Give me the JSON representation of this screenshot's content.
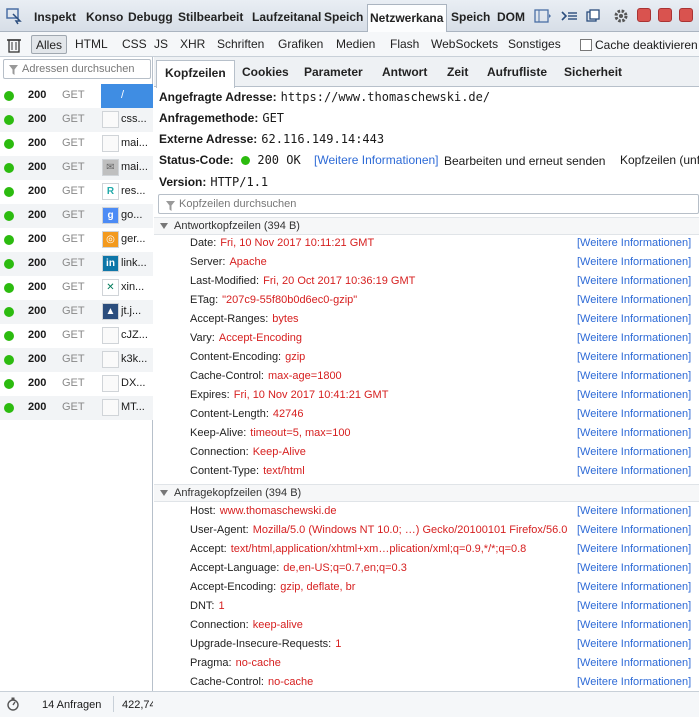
{
  "toolbar": {
    "tabs": [
      {
        "label": "Inspekt"
      },
      {
        "label": "Konso"
      },
      {
        "label": "Debugg"
      },
      {
        "label": "Stilbearbeit"
      },
      {
        "label": "Laufzeitanal"
      },
      {
        "label": "Speich"
      },
      {
        "label": "Netzwerkana"
      },
      {
        "label": "Speich"
      },
      {
        "label": "DOM"
      }
    ]
  },
  "filterbar": {
    "types": [
      "Alles",
      "HTML",
      "CSS",
      "JS",
      "XHR",
      "Schriften",
      "Grafiken",
      "Medien",
      "Flash",
      "WebSockets",
      "Sonstiges"
    ],
    "cache_label": "Cache deaktivieren"
  },
  "left": {
    "search_placeholder": "Adressen durchsuchen",
    "requests": [
      {
        "status": "200",
        "method": "GET",
        "file": "/"
      },
      {
        "status": "200",
        "method": "GET",
        "file": "css..."
      },
      {
        "status": "200",
        "method": "GET",
        "file": "mai..."
      },
      {
        "status": "200",
        "method": "GET",
        "file": "mai..."
      },
      {
        "status": "200",
        "method": "GET",
        "file": "res..."
      },
      {
        "status": "200",
        "method": "GET",
        "file": "go..."
      },
      {
        "status": "200",
        "method": "GET",
        "file": "ger..."
      },
      {
        "status": "200",
        "method": "GET",
        "file": "link..."
      },
      {
        "status": "200",
        "method": "GET",
        "file": "xin..."
      },
      {
        "status": "200",
        "method": "GET",
        "file": "jt.j..."
      },
      {
        "status": "200",
        "method": "GET",
        "file": "cJZ..."
      },
      {
        "status": "200",
        "method": "GET",
        "file": "k3k..."
      },
      {
        "status": "200",
        "method": "GET",
        "file": "DX..."
      },
      {
        "status": "200",
        "method": "GET",
        "file": "MT..."
      }
    ]
  },
  "status": {
    "requests": "14 Anfragen",
    "size": "422,74"
  },
  "panel": {
    "tabs": [
      "Kopfzeilen",
      "Cookies",
      "Parameter",
      "Antwort",
      "Zeit",
      "Aufrufliste",
      "Sicherheit"
    ],
    "summary": {
      "url_label": "Angefragte Adresse:",
      "url": "https://www.thomaschewski.de/",
      "method_label": "Anfragemethode:",
      "method": "GET",
      "remote_label": "Externe Adresse:",
      "remote": "62.116.149.14:443",
      "status_label": "Status-Code:",
      "status": "200 OK",
      "more_info": "[Weitere Informationen]",
      "edit_resend": "Bearbeiten und erneut senden",
      "raw_headers": "Kopfzeilen (unf",
      "version_label": "Version:",
      "version": "HTTP/1.1"
    },
    "header_search": "Kopfzeilen durchsuchen",
    "response_title": "Antwortkopfzeilen (394 B)",
    "response_headers": [
      {
        "name": "Date:",
        "value": "Fri, 10 Nov 2017 10:11:21 GMT"
      },
      {
        "name": "Server:",
        "value": "Apache"
      },
      {
        "name": "Last-Modified:",
        "value": "Fri, 20 Oct 2017 10:36:19 GMT"
      },
      {
        "name": "ETag:",
        "value": "\"207c9-55f80b0d6ec0-gzip\""
      },
      {
        "name": "Accept-Ranges:",
        "value": "bytes"
      },
      {
        "name": "Vary:",
        "value": "Accept-Encoding"
      },
      {
        "name": "Content-Encoding:",
        "value": "gzip"
      },
      {
        "name": "Cache-Control:",
        "value": "max-age=1800"
      },
      {
        "name": "Expires:",
        "value": "Fri, 10 Nov 2017 10:41:21 GMT"
      },
      {
        "name": "Content-Length:",
        "value": "42746"
      },
      {
        "name": "Keep-Alive:",
        "value": "timeout=5, max=100"
      },
      {
        "name": "Connection:",
        "value": "Keep-Alive"
      },
      {
        "name": "Content-Type:",
        "value": "text/html"
      }
    ],
    "request_title": "Anfragekopfzeilen (394 B)",
    "request_headers": [
      {
        "name": "Host:",
        "value": "www.thomaschewski.de"
      },
      {
        "name": "User-Agent:",
        "value": "Mozilla/5.0 (Windows NT 10.0; …) Gecko/20100101 Firefox/56.0"
      },
      {
        "name": "Accept:",
        "value": "text/html,application/xhtml+xm…plication/xml;q=0.9,*/*;q=0.8"
      },
      {
        "name": "Accept-Language:",
        "value": "de,en-US;q=0.7,en;q=0.3"
      },
      {
        "name": "Accept-Encoding:",
        "value": "gzip, deflate, br"
      },
      {
        "name": "DNT:",
        "value": "1"
      },
      {
        "name": "Connection:",
        "value": "keep-alive"
      },
      {
        "name": "Upgrade-Insecure-Requests:",
        "value": "1"
      },
      {
        "name": "Pragma:",
        "value": "no-cache"
      },
      {
        "name": "Cache-Control:",
        "value": "no-cache"
      }
    ]
  },
  "colors": {
    "status_ok": "#2cbb0f",
    "header_value": "#d61f1f",
    "link": "#2d6ad6",
    "selection": "#3f8de3"
  }
}
